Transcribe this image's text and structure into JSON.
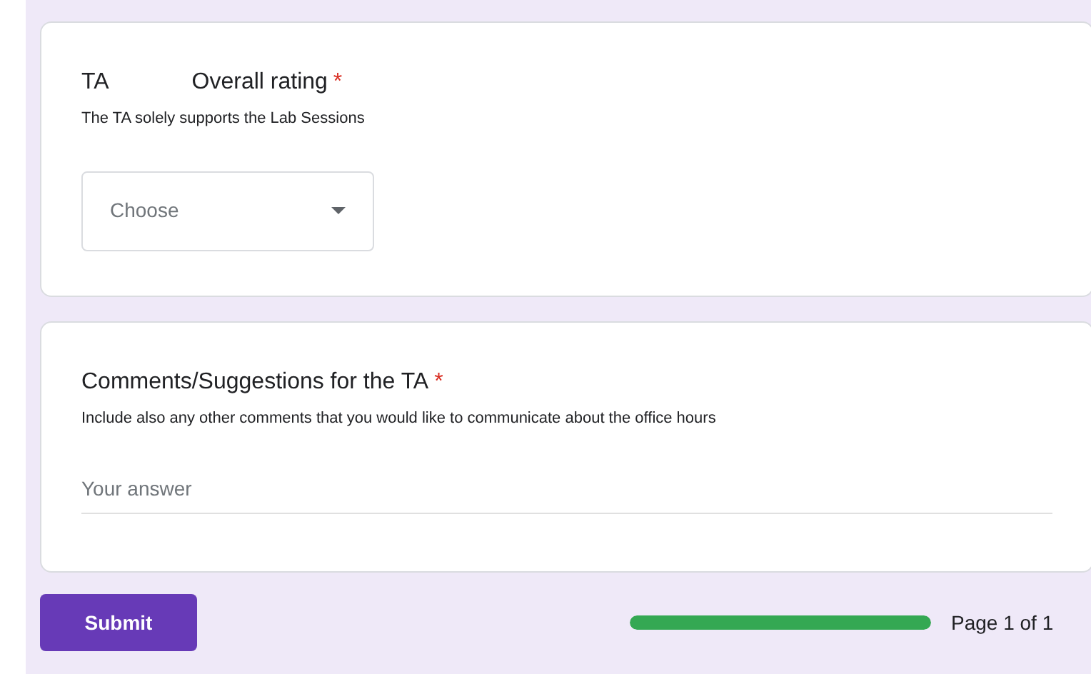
{
  "questions": [
    {
      "kind": "dropdown",
      "title_parts": [
        "TA",
        "Overall rating"
      ],
      "required_mark": "*",
      "description": "The TA solely supports the Lab Sessions",
      "placeholder": "Choose"
    },
    {
      "kind": "text",
      "title_parts": [
        "Comments/Suggestions for the TA"
      ],
      "required_mark": "*",
      "description": "Include also any other comments that you would like to communicate about the office hours",
      "placeholder": "Your answer"
    }
  ],
  "submit": "Submit",
  "progress": {
    "level": 1,
    "label": "Page 1 of 1"
  }
}
